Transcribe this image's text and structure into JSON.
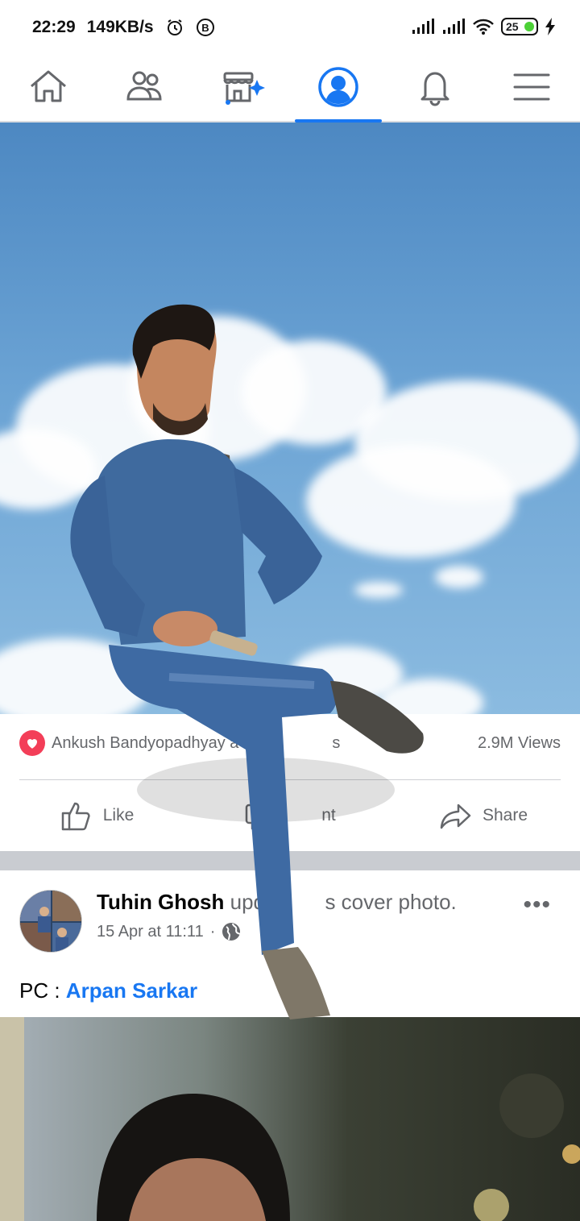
{
  "status_bar": {
    "time": "22:29",
    "speed": "149KB/s",
    "battery": "25"
  },
  "nav": {
    "items": [
      {
        "name": "home",
        "icon": "home-icon"
      },
      {
        "name": "friends",
        "icon": "friends-icon"
      },
      {
        "name": "marketplace",
        "icon": "marketplace-icon"
      },
      {
        "name": "profile",
        "icon": "profile-icon",
        "active": true
      },
      {
        "name": "notifications",
        "icon": "bell-icon"
      },
      {
        "name": "menu",
        "icon": "menu-icon"
      }
    ]
  },
  "post1": {
    "reaction_names": "Ankush Bandyopadhyay a",
    "reaction_tail": "s",
    "views": "2.9M Views",
    "like_label": "Like",
    "comment_label": "nt",
    "share_label": "Share"
  },
  "post2": {
    "author": "Tuhin Ghosh",
    "action_text": "upda",
    "action_text_tail": "s cover photo.",
    "timestamp": "15 Apr at 11:11",
    "more": "•••",
    "caption_prefix": "PC : ",
    "caption_link": "Arpan Sarkar"
  },
  "colors": {
    "accent": "#1877f2",
    "reaction_heart": "#f33e58"
  }
}
